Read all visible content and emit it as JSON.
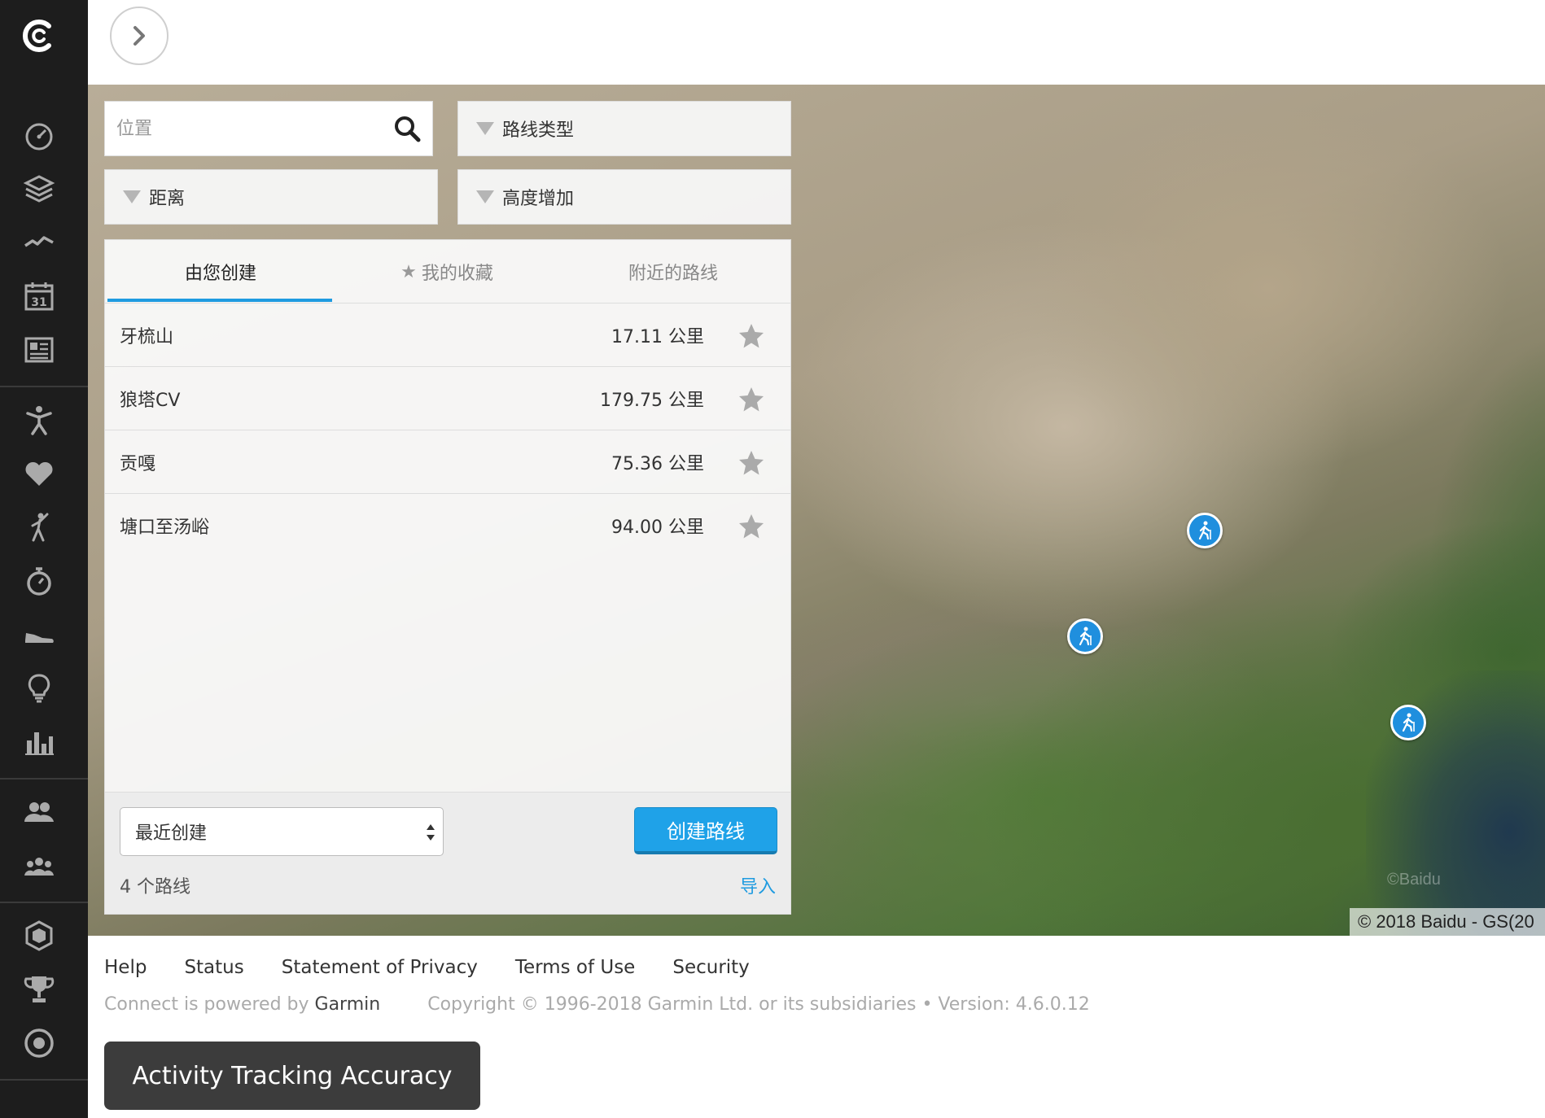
{
  "sidebar": {
    "items": [
      {
        "name": "dashboard",
        "icon": "gauge-icon"
      },
      {
        "name": "layers",
        "icon": "layers-icon"
      },
      {
        "name": "activities",
        "icon": "activity-wave-icon"
      },
      {
        "name": "calendar",
        "icon": "calendar-icon",
        "label": "31"
      },
      {
        "name": "reports",
        "icon": "news-icon"
      },
      {
        "name": "fitness",
        "icon": "person-stretch-icon"
      },
      {
        "name": "health",
        "icon": "heart-icon"
      },
      {
        "name": "golf",
        "icon": "golfer-icon"
      },
      {
        "name": "timer",
        "icon": "stopwatch-icon"
      },
      {
        "name": "gear",
        "icon": "shoe-icon"
      },
      {
        "name": "insights",
        "icon": "lightbulb-icon"
      },
      {
        "name": "stats",
        "icon": "bar-chart-icon"
      },
      {
        "name": "connections",
        "icon": "people-icon"
      },
      {
        "name": "groups",
        "icon": "group-icon"
      },
      {
        "name": "badges",
        "icon": "hexagon-badge-icon"
      },
      {
        "name": "challenges",
        "icon": "trophy-icon"
      },
      {
        "name": "goals",
        "icon": "target-icon"
      }
    ]
  },
  "search": {
    "placeholder": "位置"
  },
  "filters": {
    "route_type": "路线类型",
    "distance": "距离",
    "elevation_gain": "高度增加"
  },
  "tabs": [
    {
      "label": "由您创建",
      "active": true
    },
    {
      "label": "我的收藏",
      "active": false
    },
    {
      "label": "附近的路线",
      "active": false
    }
  ],
  "routes": [
    {
      "name": "牙梳山",
      "distance": "17.11 公里"
    },
    {
      "name": "狼塔CV",
      "distance": "179.75 公里"
    },
    {
      "name": "贡嘎",
      "distance": "75.36 公里"
    },
    {
      "name": "塘口至汤峪",
      "distance": "94.00 公里"
    }
  ],
  "panel_footer": {
    "sort_value": "最近创建",
    "create_button": "创建路线",
    "count": "4 个路线",
    "import": "导入"
  },
  "map": {
    "copyright": "© 2018 Baidu - GS(20",
    "watermark": "©Baidu"
  },
  "footer": {
    "links": [
      "Help",
      "Status",
      "Statement of Privacy",
      "Terms of Use",
      "Security"
    ],
    "powered_prefix": "Connect is powered by",
    "powered_brand": "Garmin",
    "copyright": "Copyright © 1996-2018 Garmin Ltd. or its subsidiaries • Version: 4.6.0.12",
    "accuracy_button": "Activity Tracking Accuracy"
  },
  "colors": {
    "accent": "#1f9be0",
    "sidebar_bg": "#1d1d1d",
    "marker": "#1f8fde"
  }
}
